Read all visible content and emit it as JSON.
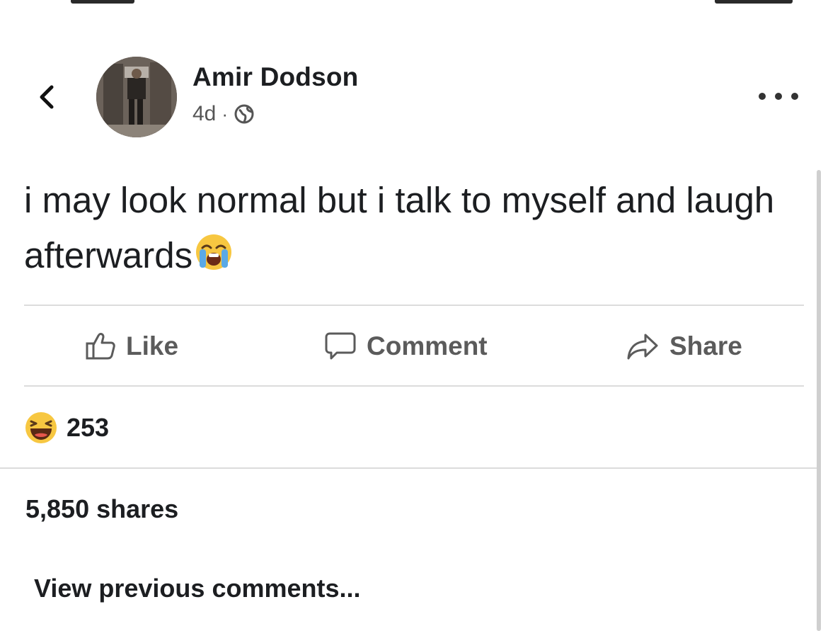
{
  "post": {
    "author": "Amir Dodson",
    "time": "4d",
    "separator": "·",
    "privacy_icon": "globe-icon",
    "text_main": "i may look normal but i talk to myself and laugh afterwards",
    "text_emoji": "loudly-crying-face-emoji"
  },
  "actions": {
    "like": "Like",
    "comment": "Comment",
    "share": "Share"
  },
  "reactions": {
    "icon": "haha-reaction-icon",
    "count": "253"
  },
  "shares": {
    "label": "5,850 shares"
  },
  "comments": {
    "view_previous": "View previous comments..."
  },
  "colors": {
    "text": "#1c1e21",
    "muted": "#5b5b5b",
    "divider": "#dcdcdc",
    "haha_face": "#f7c741"
  }
}
